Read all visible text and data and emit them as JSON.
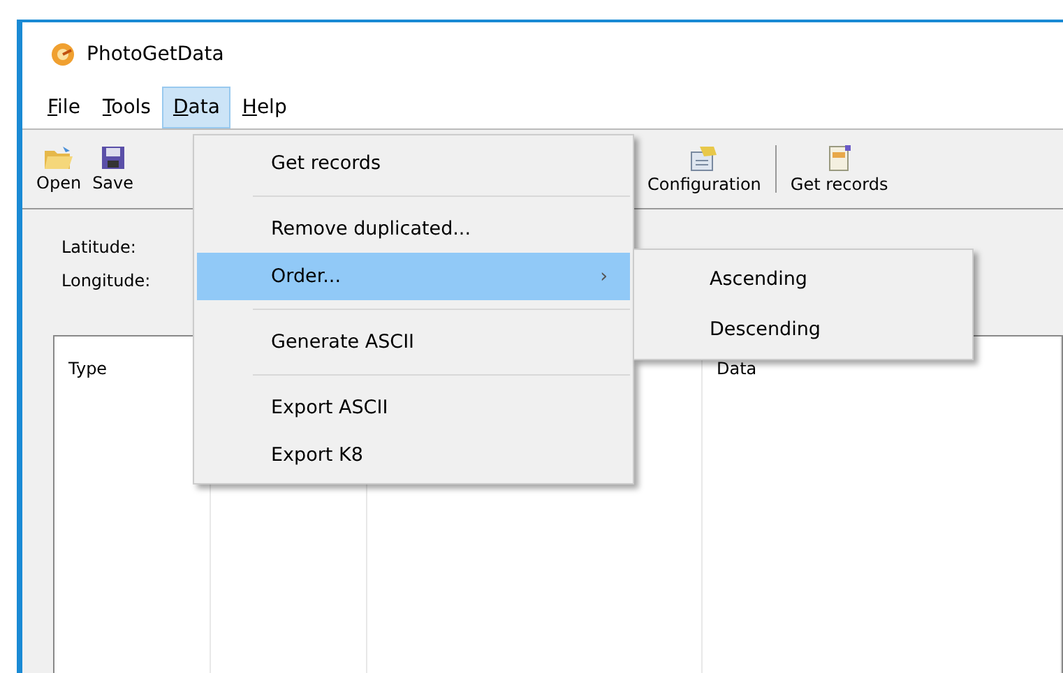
{
  "window": {
    "title": "PhotoGetData"
  },
  "menu_bar": [
    {
      "mnemonic": "F",
      "rest": "ile",
      "selected": false
    },
    {
      "mnemonic": "T",
      "rest": "ools",
      "selected": false
    },
    {
      "mnemonic": "D",
      "rest": "ata",
      "selected": true
    },
    {
      "mnemonic": "H",
      "rest": "elp",
      "selected": false
    }
  ],
  "toolbar": [
    {
      "label": "Open",
      "kind": "open"
    },
    {
      "label": "Save",
      "kind": "save"
    },
    {
      "label": "Configuration",
      "kind": "config"
    },
    {
      "label": "Get records",
      "kind": "records"
    }
  ],
  "fields": [
    "Latitude:",
    "Longitude:"
  ],
  "table": {
    "columns": [
      "Type",
      "Data"
    ]
  },
  "data_menu": [
    {
      "label": "Get records",
      "kind": "item",
      "highlighted": false
    },
    {
      "kind": "separator"
    },
    {
      "label": "Remove duplicated...",
      "kind": "item",
      "highlighted": false
    },
    {
      "label": "Order...",
      "kind": "submenu",
      "highlighted": true,
      "arrow": "›"
    },
    {
      "kind": "separator"
    },
    {
      "label": "Generate ASCII",
      "kind": "item",
      "highlighted": false
    },
    {
      "kind": "separator"
    },
    {
      "label": "Export ASCII",
      "kind": "item",
      "highlighted": false
    },
    {
      "label": "Export K8",
      "kind": "item",
      "highlighted": false
    }
  ],
  "order_submenu": [
    "Ascending",
    "Descending"
  ]
}
